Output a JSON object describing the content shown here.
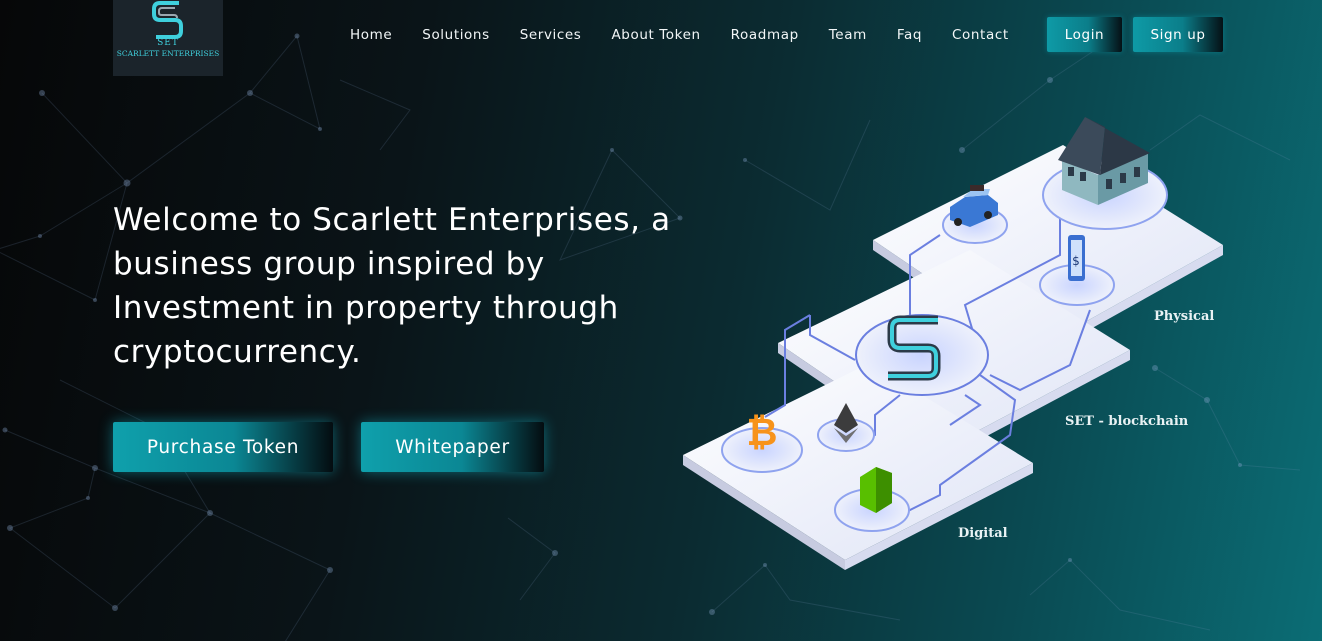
{
  "logo": {
    "abbr": "SET",
    "name": "SCARLETT ENTERPRISES"
  },
  "nav": {
    "items": [
      "Home",
      "Solutions",
      "Services",
      "About Token",
      "Roadmap",
      "Team",
      "Faq",
      "Contact"
    ],
    "login": "Login",
    "signup": "Sign up"
  },
  "hero": {
    "title": "Welcome to Scarlett Enterprises, a business group inspired by Investment in property through cryptocurrency.",
    "purchase_button": "Purchase Token",
    "whitepaper_button": "Whitepaper"
  },
  "illustration": {
    "labels": {
      "physical": "Physical",
      "blockchain": "SET - blockchain",
      "digital": "Digital"
    }
  },
  "colors": {
    "accent": "#0e9aa6",
    "accent_dark": "#0b7e8a",
    "logo_teal": "#3fd0dd",
    "bg_dark": "#060708",
    "bg_teal": "#0b6d75"
  }
}
